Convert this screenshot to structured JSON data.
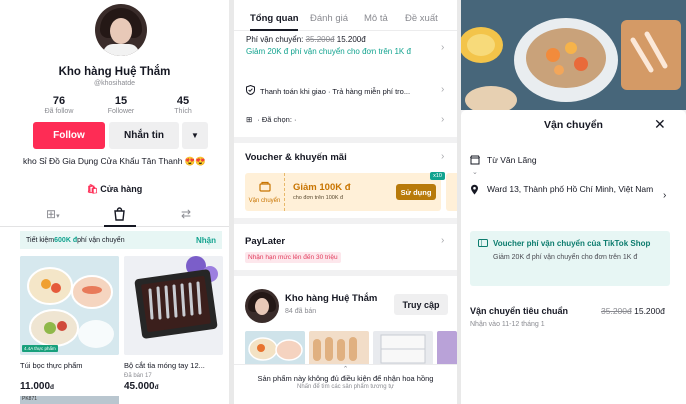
{
  "profile": {
    "name": "Kho hàng Huệ Thắm",
    "handle": "@khosihatde",
    "stats": [
      {
        "value": "76",
        "label": "Đã follow"
      },
      {
        "value": "15",
        "label": "Follower"
      },
      {
        "value": "45",
        "label": "Thích"
      }
    ],
    "follow_label": "Follow",
    "message_label": "Nhắn tin",
    "bio": "kho Sỉ Đồ Gia Dụng Cửa Khẩu Tân Thanh 😍😍",
    "shop_link": "Cửa hàng",
    "promo": {
      "prefix": "Tiết kiệm ",
      "highlight": "600K đ",
      "suffix": " phí vận chuyển",
      "claim": "Nhận"
    },
    "products": [
      {
        "title": "Túi bọc thực phẩm",
        "sold": "",
        "price": "11.000",
        "currency": "đ",
        "badge": "4.4A thực phẩm"
      },
      {
        "title": "Bộ cắt tỉa móng tay 12...",
        "sold": "Đã bán 17",
        "price": "45.000",
        "currency": "đ",
        "badge": ""
      }
    ],
    "next_card_label": "PK871"
  },
  "detail": {
    "tabs": [
      "Tổng quan",
      "Đánh giá",
      "Mô tả",
      "Đề xuất"
    ],
    "shipping": {
      "label": "Phí vận chuyển: ",
      "old_price": "35.200đ",
      "new_price": "15.200đ",
      "promo": "Giảm 20K đ phí vận chuyển cho đơn trên 1K đ"
    },
    "payment_row": "Thanh toán khi giao · Trả hàng miễn phí tro...",
    "variant_row": "· Đã chọn: ·",
    "voucher_section": "Voucher & khuyến mãi",
    "voucher": {
      "type_label": "Vận chuyển",
      "amount": "Giảm 100K đ",
      "condition": "cho đơn trên 100K đ",
      "use_label": "Sử dụng",
      "count": "x10"
    },
    "paylater": {
      "title": "PayLater",
      "subtitle": "Nhận hạn mức lên đến 30 triệu"
    },
    "shop": {
      "name": "Kho hàng Huệ Thắm",
      "sold": "84 đã bán",
      "visit_label": "Truy cập"
    },
    "notice": {
      "main": "Sản phẩm này không đủ điều kiện để nhận hoa hồng",
      "sub": "Nhấn để tìm các sản phẩm tương tự"
    }
  },
  "shipping_sheet": {
    "title": "Vận chuyển",
    "from_label": "Từ Văn Lãng",
    "to_address": "Ward 13, Thành phố Hồ Chí Minh, Việt Nam",
    "voucher_title": "Voucher phí vận chuyển của TikTok Shop",
    "voucher_desc": "Giảm 20K đ phí vận chuyển cho đơn trên 1K đ",
    "standard_label": "Vận chuyển tiêu chuẩn",
    "standard_old": "35.200đ",
    "standard_new": "15.200đ",
    "eta": "Nhận vào 11-12 tháng 1"
  }
}
